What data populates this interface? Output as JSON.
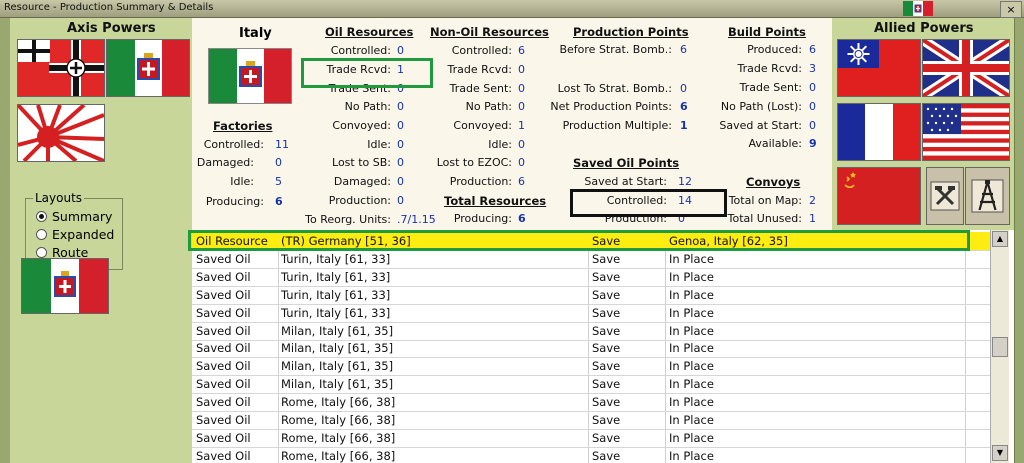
{
  "window": {
    "title": "Resource - Production Summary & Details",
    "close": "×"
  },
  "left": {
    "header": "Axis Powers",
    "layouts_title": "Layouts",
    "layouts": [
      "Summary",
      "Expanded",
      "Route"
    ],
    "selected_layout": "Summary"
  },
  "right": {
    "header": "Allied Powers"
  },
  "country": {
    "name": "Italy"
  },
  "factories": {
    "header": "Factories",
    "rows": [
      {
        "label": "Controlled:",
        "value": "11"
      },
      {
        "label": "Damaged:",
        "value": "0"
      },
      {
        "label": "Idle:",
        "value": "5"
      },
      {
        "label": "Producing:",
        "value": "6"
      }
    ]
  },
  "oil": {
    "header": "Oil Resources",
    "rows": [
      {
        "label": "Controlled:",
        "value": "0"
      },
      {
        "label": "Trade Rcvd:",
        "value": "1"
      },
      {
        "label": "Trade Sent:",
        "value": "0"
      },
      {
        "label": "No Path:",
        "value": "0"
      },
      {
        "label": "Convoyed:",
        "value": "0"
      },
      {
        "label": "Idle:",
        "value": "0"
      },
      {
        "label": "Lost to SB:",
        "value": "0"
      },
      {
        "label": "Damaged:",
        "value": "0"
      },
      {
        "label": "Production:",
        "value": "0"
      },
      {
        "label": "To Reorg. Units:",
        "value": ".7/1.15"
      }
    ]
  },
  "nonoil": {
    "header": "Non-Oil Resources",
    "rows": [
      {
        "label": "Controlled:",
        "value": "6"
      },
      {
        "label": "Trade Rcvd:",
        "value": "0"
      },
      {
        "label": "Trade Sent:",
        "value": "0"
      },
      {
        "label": "No Path:",
        "value": "0"
      },
      {
        "label": "Convoyed:",
        "value": "1"
      },
      {
        "label": "Idle:",
        "value": "0"
      },
      {
        "label": "Lost to EZOC:",
        "value": "0"
      },
      {
        "label": "Production:",
        "value": "6"
      }
    ],
    "total_header": "Total Resources",
    "total_producing_label": "Producing:",
    "total_producing_value": "6"
  },
  "production": {
    "header": "Production Points",
    "before_label": "Before Strat. Bomb.:",
    "before_value": "6",
    "lost_label": "Lost To Strat. Bomb.:",
    "lost_value": "0",
    "net_label": "Net Production Points:",
    "net_value": "6",
    "mult_label": "Production Multiple:",
    "mult_value": "1"
  },
  "saved_oil": {
    "header": "Saved Oil Points",
    "rows": [
      {
        "label": "Saved at Start:",
        "value": "12"
      },
      {
        "label": "Controlled:",
        "value": "14"
      },
      {
        "label": "Production:",
        "value": "0"
      }
    ]
  },
  "build": {
    "header": "Build Points",
    "rows": [
      {
        "label": "Produced:",
        "value": "6"
      },
      {
        "label": "Trade Rcvd:",
        "value": "3"
      },
      {
        "label": "Trade Sent:",
        "value": "0"
      },
      {
        "label": "No Path (Lost):",
        "value": "0"
      },
      {
        "label": "Saved at Start:",
        "value": "0"
      },
      {
        "label": "Available:",
        "value": "9"
      }
    ]
  },
  "convoys": {
    "header": "Convoys",
    "rows": [
      {
        "label": "Total on Map:",
        "value": "2"
      },
      {
        "label": "Total Unused:",
        "value": "1"
      }
    ]
  },
  "table": {
    "rows": [
      {
        "type": "Oil Resource",
        "loc": "(TR) Germany [51, 36]",
        "action": "Save",
        "dest": "Genoa, Italy [62, 35]",
        "highlight": true
      },
      {
        "type": "Saved Oil",
        "loc": "Turin, Italy [61, 33]",
        "action": "Save",
        "dest": "In Place"
      },
      {
        "type": "Saved Oil",
        "loc": "Turin, Italy [61, 33]",
        "action": "Save",
        "dest": "In Place"
      },
      {
        "type": "Saved Oil",
        "loc": "Turin, Italy [61, 33]",
        "action": "Save",
        "dest": "In Place"
      },
      {
        "type": "Saved Oil",
        "loc": "Turin, Italy [61, 33]",
        "action": "Save",
        "dest": "In Place"
      },
      {
        "type": "Saved Oil",
        "loc": "Milan, Italy [61, 35]",
        "action": "Save",
        "dest": "In Place"
      },
      {
        "type": "Saved Oil",
        "loc": "Milan, Italy [61, 35]",
        "action": "Save",
        "dest": "In Place"
      },
      {
        "type": "Saved Oil",
        "loc": "Milan, Italy [61, 35]",
        "action": "Save",
        "dest": "In Place"
      },
      {
        "type": "Saved Oil",
        "loc": "Milan, Italy [61, 35]",
        "action": "Save",
        "dest": "In Place"
      },
      {
        "type": "Saved Oil",
        "loc": "Rome, Italy [66, 38]",
        "action": "Save",
        "dest": "In Place"
      },
      {
        "type": "Saved Oil",
        "loc": "Rome, Italy [66, 38]",
        "action": "Save",
        "dest": "In Place"
      },
      {
        "type": "Saved Oil",
        "loc": "Rome, Italy [66, 38]",
        "action": "Save",
        "dest": "In Place"
      },
      {
        "type": "Saved Oil",
        "loc": "Rome, Italy [66, 38]",
        "action": "Save",
        "dest": "In Place"
      }
    ]
  },
  "colors": {
    "highlight": "#ffec10",
    "value_blue": "#1733a8",
    "panel": "#c8d69a",
    "summary_bg": "#faf6ea",
    "green_box": "#1f9a3c"
  }
}
